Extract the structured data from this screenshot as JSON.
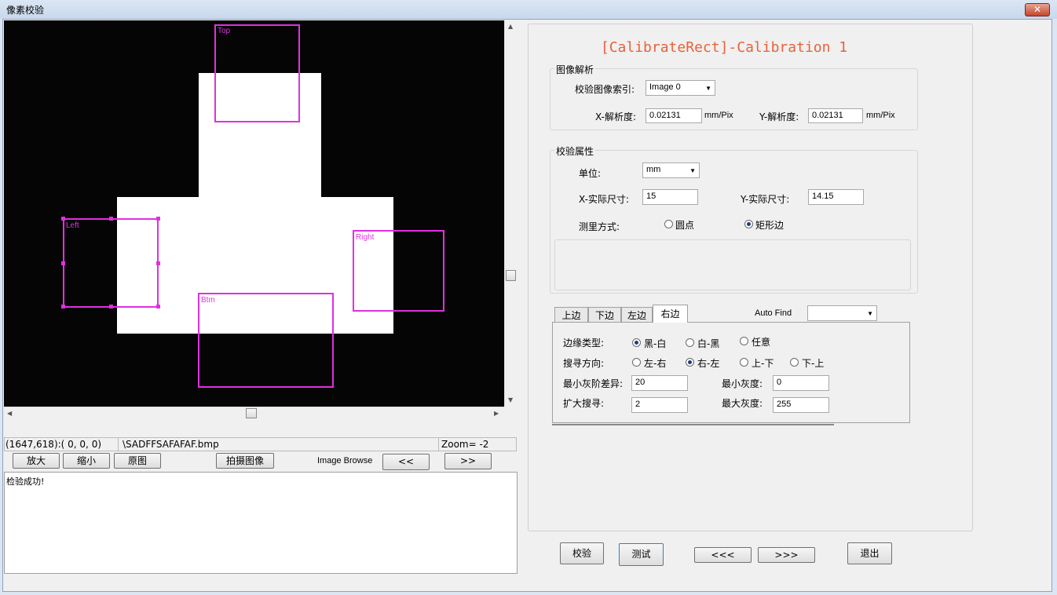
{
  "window": {
    "title": "像素校验",
    "close_glyph": "✕"
  },
  "viewer": {
    "rois": [
      {
        "label": "Top"
      },
      {
        "label": "Left"
      },
      {
        "label": "Right"
      },
      {
        "label": "Btm"
      }
    ],
    "status": {
      "coords": "(1647,618):(  0,  0,  0)",
      "filename": "\\SADFFSAFAFAF.bmp",
      "zoom": "Zoom= -2"
    }
  },
  "toolbar": {
    "zoom_in": "放大",
    "zoom_out": "缩小",
    "original": "原图",
    "capture": "拍摄图像",
    "browse_label": "Image Browse",
    "prev": "<<",
    "next": ">>"
  },
  "log": {
    "text": "检验成功!"
  },
  "panel": {
    "title": "[CalibrateRect]-Calibration 1",
    "image_group": {
      "title": "图像解析",
      "index_label": "校验图像索引:",
      "index_value": "Image 0",
      "x_res_label": "X-解析度:",
      "x_res_value": "0.02131",
      "x_res_unit": "mm/Pix",
      "y_res_label": "Y-解析度:",
      "y_res_value": "0.02131",
      "y_res_unit": "mm/Pix"
    },
    "attr_group": {
      "title": "校验属性",
      "unit_label": "单位:",
      "unit_value": "mm",
      "x_size_label": "X-实际尺寸:",
      "x_size_value": "15",
      "y_size_label": "Y-实际尺寸:",
      "y_size_value": "14.15",
      "method_label": "测里方式:",
      "method_dot": "圆点",
      "method_rect": "矩形边",
      "method_selected": "矩形边"
    },
    "tabs": [
      "上边",
      "下边",
      "左边",
      "右边"
    ],
    "active_tab": "右边",
    "auto_find_label": "Auto Find",
    "auto_find_value": "",
    "edge": {
      "type_label": "边缘类型:",
      "type_options": [
        "黑-白",
        "白-黑",
        "任意"
      ],
      "type_selected": "黑-白",
      "dir_label": "搜寻方向:",
      "dir_options": [
        "左-右",
        "右-左",
        "上-下",
        "下-上"
      ],
      "dir_selected": "右-左",
      "min_gray_diff_label": "最小灰阶差异:",
      "min_gray_diff_value": "20",
      "min_gray_label": "最小灰度:",
      "min_gray_value": "0",
      "expand_label": "扩大搜寻:",
      "expand_value": "2",
      "max_gray_label": "最大灰度:",
      "max_gray_value": "255"
    },
    "buttons": {
      "verify": "校验",
      "test": "测试",
      "prev": "<<<",
      "next": ">>>",
      "exit": "退出"
    }
  }
}
